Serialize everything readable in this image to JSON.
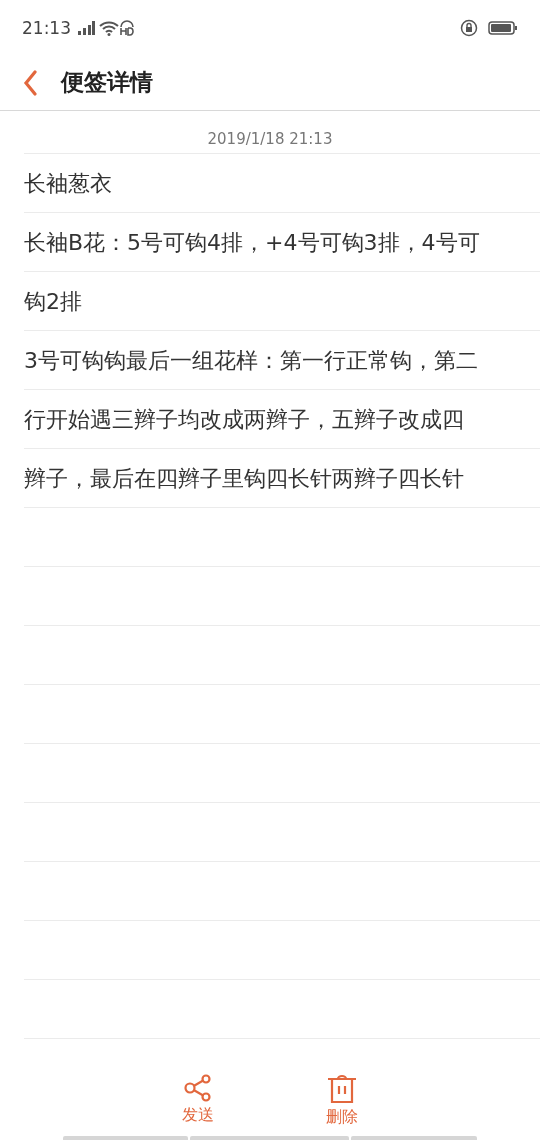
{
  "status_bar": {
    "time": "21:13"
  },
  "header": {
    "title": "便签详情"
  },
  "note": {
    "date": "2019/1/18 21:13",
    "lines": [
      "长袖葱衣",
      "长袖B花：5号可钩4排，+4号可钩3排，4号可",
      "钩2排",
      "3号可钩钩最后一组花样：第一行正常钩，第二",
      "行开始遇三辫子均改成两辫子，五辫子改成四",
      "辫子，最后在四辫子里钩四长针两辫子四长针"
    ]
  },
  "toolbar": [
    {
      "kind": "share",
      "label": "发送"
    },
    {
      "kind": "delete",
      "label": "删除"
    }
  ]
}
